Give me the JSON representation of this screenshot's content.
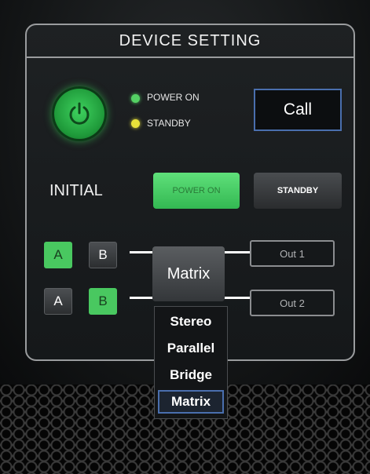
{
  "panel": {
    "title": "DEVICE SETTING"
  },
  "status": {
    "power_on_label": "POWER ON",
    "standby_label": "STANDBY",
    "power_on_color": "#54d164",
    "standby_color": "#e8e23a"
  },
  "power_button": {
    "icon": "power-icon",
    "color": "#2fb24a"
  },
  "call_button": {
    "label": "Call"
  },
  "initial": {
    "label": "INITIAL",
    "power_on_button": "POWER ON",
    "standby_button": "STANDBY"
  },
  "channels": {
    "row1": {
      "a": "A",
      "b": "B",
      "selected": "A"
    },
    "row2": {
      "a": "A",
      "b": "B",
      "selected": "B"
    }
  },
  "matrix": {
    "label": "Matrix"
  },
  "outputs": {
    "out1": "Out 1",
    "out2": "Out 2"
  },
  "mode_dropdown": {
    "options": [
      "Stereo",
      "Parallel",
      "Bridge",
      "Matrix"
    ],
    "selected": "Matrix"
  },
  "colors": {
    "accent_green": "#49c860",
    "border": "#9a9c9e",
    "highlight_blue": "#4a6fae"
  }
}
